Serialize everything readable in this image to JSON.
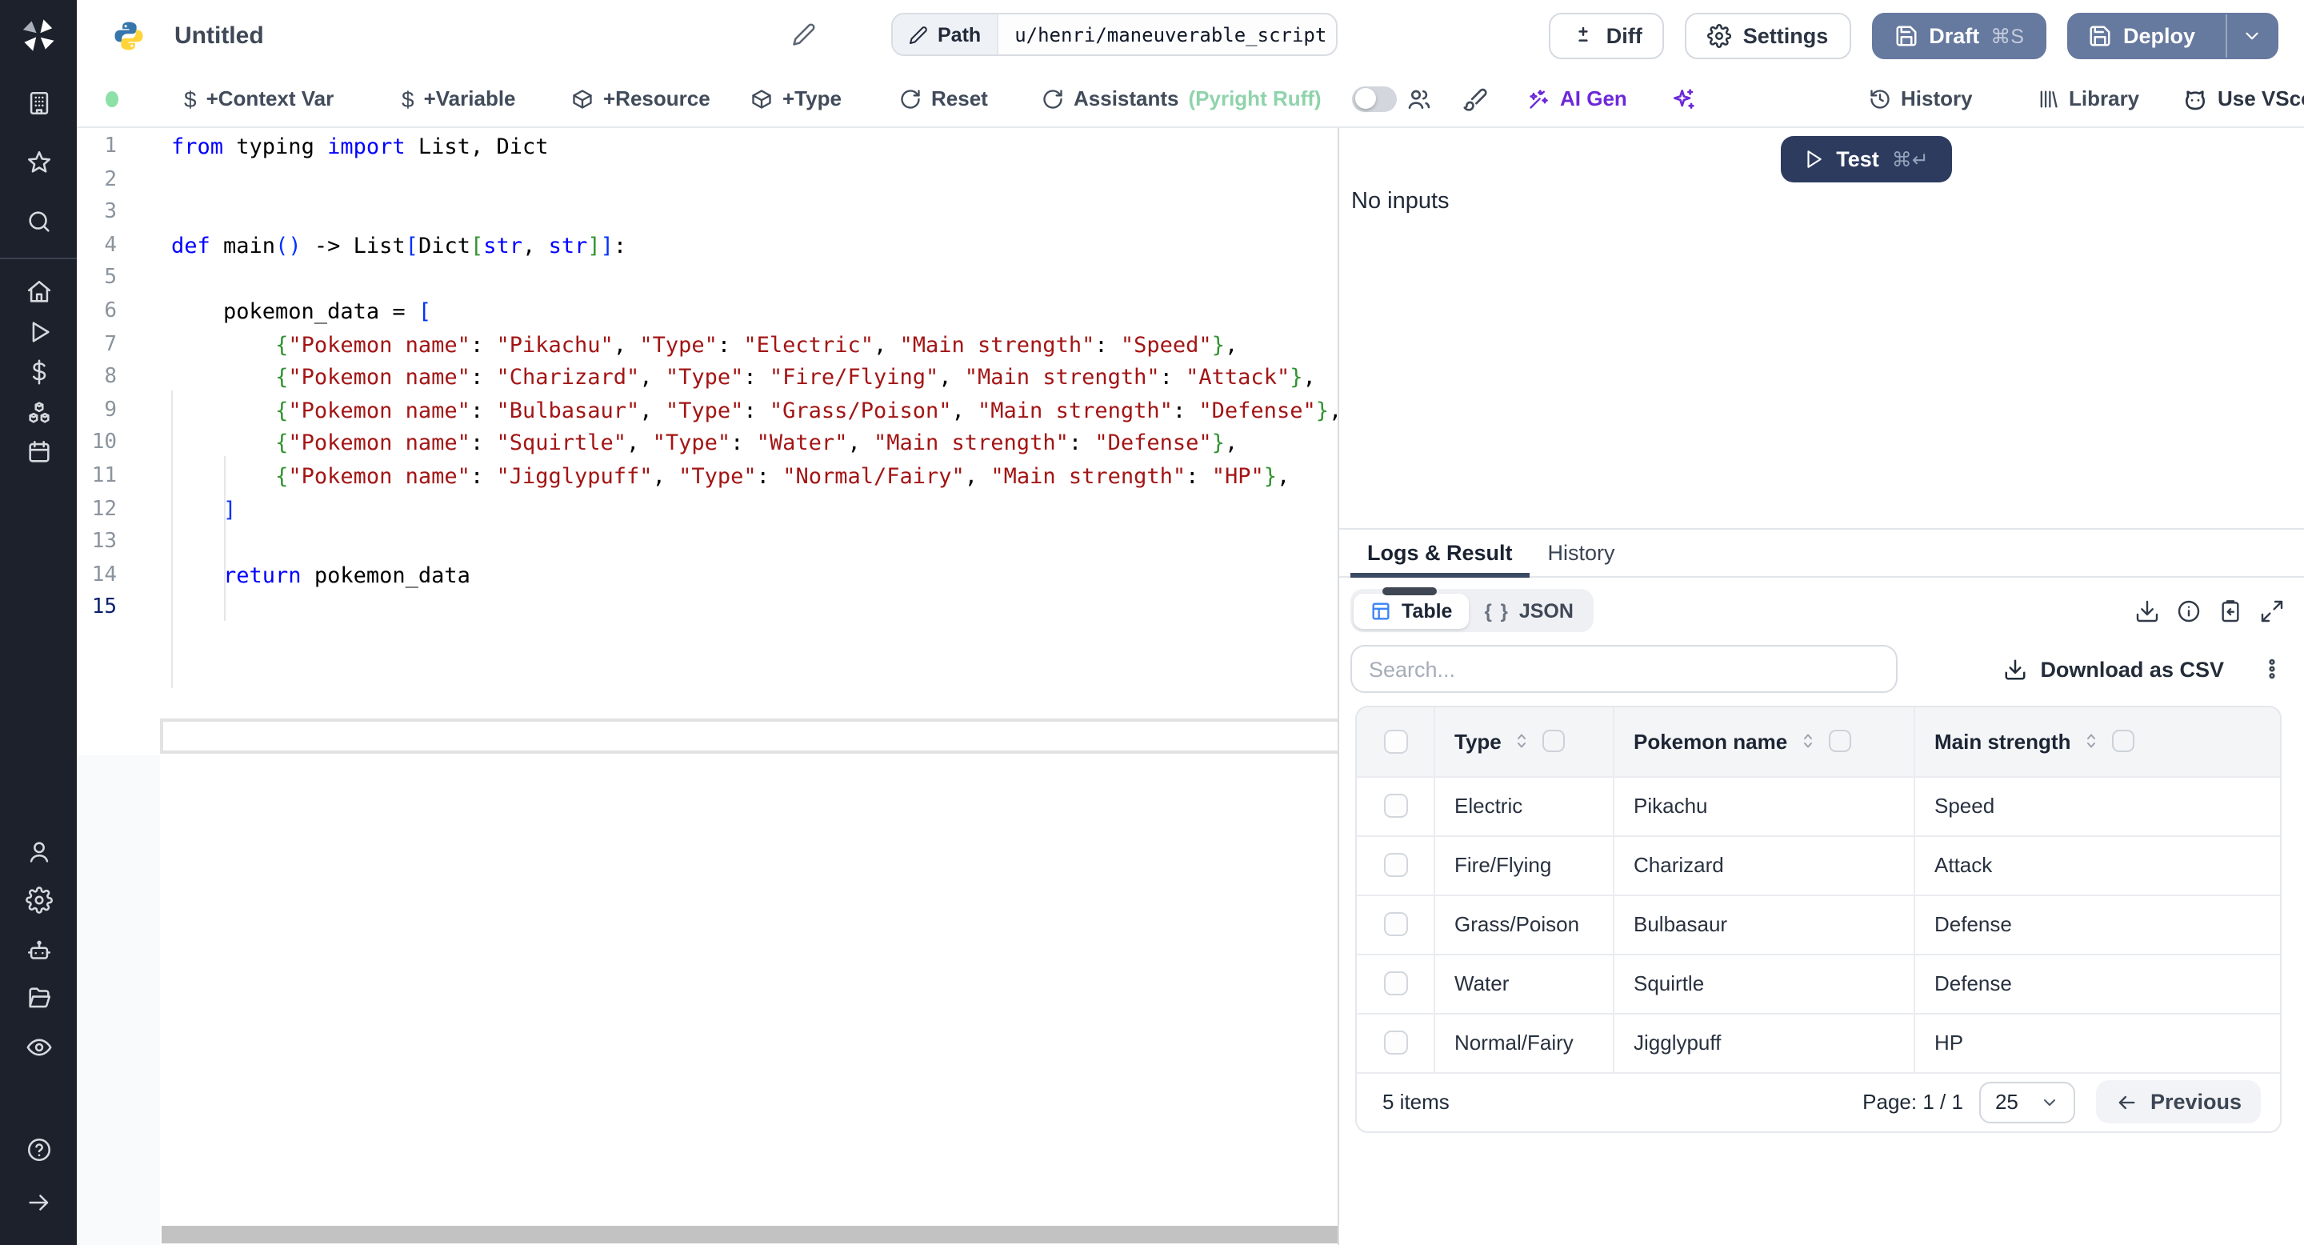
{
  "topbar": {
    "title": "Untitled",
    "path_label": "Path",
    "path_value": "u/henri/maneuverable_script",
    "diff_label": "Diff",
    "settings_label": "Settings",
    "draft_label": "Draft",
    "draft_shortcut": "⌘S",
    "deploy_label": "Deploy"
  },
  "toolbar": {
    "context_var": "+Context Var",
    "variable": "+Variable",
    "resource": "+Resource",
    "type": "+Type",
    "reset": "Reset",
    "assistants": "Assistants",
    "assistants_detail": "(Pyright Ruff)",
    "ai_gen": "AI Gen",
    "history": "History",
    "library": "Library",
    "vscode": "Use VScode"
  },
  "editor": {
    "language": "python",
    "lines": [
      {
        "n": "1",
        "segs": [
          [
            "kw",
            "from"
          ],
          [
            "pl",
            " typing "
          ],
          [
            "kw",
            "import"
          ],
          [
            "pl",
            " List, Dict"
          ]
        ]
      },
      {
        "n": "2",
        "segs": []
      },
      {
        "n": "3",
        "segs": []
      },
      {
        "n": "4",
        "segs": [
          [
            "kw",
            "def"
          ],
          [
            "pl",
            " main"
          ],
          [
            "b1",
            "()"
          ],
          [
            "pl",
            " -> List"
          ],
          [
            "b1",
            "["
          ],
          [
            "pl",
            "Dict"
          ],
          [
            "b2",
            "["
          ],
          [
            "kw",
            "str"
          ],
          [
            "pl",
            ", "
          ],
          [
            "kw",
            "str"
          ],
          [
            "b2",
            "]"
          ],
          [
            "b1",
            "]"
          ],
          [
            "pl",
            ":"
          ]
        ]
      },
      {
        "n": "5",
        "segs": []
      },
      {
        "n": "6",
        "segs": [
          [
            "pl",
            "    pokemon_data = "
          ],
          [
            "b1",
            "["
          ]
        ]
      },
      {
        "n": "7",
        "segs": [
          [
            "pl",
            "        "
          ],
          [
            "b2",
            "{"
          ],
          [
            "str",
            "\"Pokemon name\""
          ],
          [
            "pl",
            ": "
          ],
          [
            "str",
            "\"Pikachu\""
          ],
          [
            "pl",
            ", "
          ],
          [
            "str",
            "\"Type\""
          ],
          [
            "pl",
            ": "
          ],
          [
            "str",
            "\"Electric\""
          ],
          [
            "pl",
            ", "
          ],
          [
            "str",
            "\"Main strength\""
          ],
          [
            "pl",
            ": "
          ],
          [
            "str",
            "\"Speed\""
          ],
          [
            "b2",
            "}"
          ],
          [
            "pl",
            ","
          ]
        ]
      },
      {
        "n": "8",
        "segs": [
          [
            "pl",
            "        "
          ],
          [
            "b2",
            "{"
          ],
          [
            "str",
            "\"Pokemon name\""
          ],
          [
            "pl",
            ": "
          ],
          [
            "str",
            "\"Charizard\""
          ],
          [
            "pl",
            ", "
          ],
          [
            "str",
            "\"Type\""
          ],
          [
            "pl",
            ": "
          ],
          [
            "str",
            "\"Fire/Flying\""
          ],
          [
            "pl",
            ", "
          ],
          [
            "str",
            "\"Main strength\""
          ],
          [
            "pl",
            ": "
          ],
          [
            "str",
            "\"Attack\""
          ],
          [
            "b2",
            "}"
          ],
          [
            "pl",
            ","
          ]
        ]
      },
      {
        "n": "9",
        "segs": [
          [
            "pl",
            "        "
          ],
          [
            "b2",
            "{"
          ],
          [
            "str",
            "\"Pokemon name\""
          ],
          [
            "pl",
            ": "
          ],
          [
            "str",
            "\"Bulbasaur\""
          ],
          [
            "pl",
            ", "
          ],
          [
            "str",
            "\"Type\""
          ],
          [
            "pl",
            ": "
          ],
          [
            "str",
            "\"Grass/Poison\""
          ],
          [
            "pl",
            ", "
          ],
          [
            "str",
            "\"Main strength\""
          ],
          [
            "pl",
            ": "
          ],
          [
            "str",
            "\"Defense\""
          ],
          [
            "b2",
            "}"
          ],
          [
            "pl",
            ","
          ]
        ]
      },
      {
        "n": "10",
        "segs": [
          [
            "pl",
            "        "
          ],
          [
            "b2",
            "{"
          ],
          [
            "str",
            "\"Pokemon name\""
          ],
          [
            "pl",
            ": "
          ],
          [
            "str",
            "\"Squirtle\""
          ],
          [
            "pl",
            ", "
          ],
          [
            "str",
            "\"Type\""
          ],
          [
            "pl",
            ": "
          ],
          [
            "str",
            "\"Water\""
          ],
          [
            "pl",
            ", "
          ],
          [
            "str",
            "\"Main strength\""
          ],
          [
            "pl",
            ": "
          ],
          [
            "str",
            "\"Defense\""
          ],
          [
            "b2",
            "}"
          ],
          [
            "pl",
            ","
          ]
        ]
      },
      {
        "n": "11",
        "segs": [
          [
            "pl",
            "        "
          ],
          [
            "b2",
            "{"
          ],
          [
            "str",
            "\"Pokemon name\""
          ],
          [
            "pl",
            ": "
          ],
          [
            "str",
            "\"Jigglypuff\""
          ],
          [
            "pl",
            ", "
          ],
          [
            "str",
            "\"Type\""
          ],
          [
            "pl",
            ": "
          ],
          [
            "str",
            "\"Normal/Fairy\""
          ],
          [
            "pl",
            ", "
          ],
          [
            "str",
            "\"Main strength\""
          ],
          [
            "pl",
            ": "
          ],
          [
            "str",
            "\"HP\""
          ],
          [
            "b2",
            "}"
          ],
          [
            "pl",
            ","
          ]
        ]
      },
      {
        "n": "12",
        "segs": [
          [
            "pl",
            "    "
          ],
          [
            "b1",
            "]"
          ]
        ]
      },
      {
        "n": "13",
        "segs": []
      },
      {
        "n": "14",
        "segs": [
          [
            "pl",
            "    "
          ],
          [
            "kw",
            "return"
          ],
          [
            "pl",
            " pokemon_data"
          ]
        ]
      },
      {
        "n": "15",
        "segs": [],
        "active": true
      }
    ]
  },
  "run_panel": {
    "test_label": "Test",
    "test_shortcut": "⌘↵",
    "no_inputs": "No inputs"
  },
  "result_panel": {
    "tabs": {
      "logs": "Logs & Result",
      "history": "History"
    },
    "view_toggle": {
      "table": "Table",
      "json": "JSON",
      "json_icon": "{ }"
    },
    "search_placeholder": "Search...",
    "download_csv": "Download as CSV",
    "table": {
      "columns": [
        "Type",
        "Pokemon name",
        "Main strength"
      ],
      "rows": [
        [
          "Electric",
          "Pikachu",
          "Speed"
        ],
        [
          "Fire/Flying",
          "Charizard",
          "Attack"
        ],
        [
          "Grass/Poison",
          "Bulbasaur",
          "Defense"
        ],
        [
          "Water",
          "Squirtle",
          "Defense"
        ],
        [
          "Normal/Fairy",
          "Jigglypuff",
          "HP"
        ]
      ]
    },
    "footer": {
      "items_count": "5 items",
      "page_label": "Page: 1 / 1",
      "page_size": "25",
      "previous_label": "Previous"
    }
  },
  "colors": {
    "sidebar_bg": "#1c212b",
    "accent_slate": "#66799f",
    "dark_navy": "#2d3b5f",
    "ai_purple": "#6d28d9",
    "success_green": "#8ce0a8",
    "assistants_green": "#8fd3ab",
    "table_icon_blue": "#3b82f6",
    "keyword_blue": "#0000ff",
    "string_red": "#a31515",
    "bracket_blue": "#0431fa",
    "bracket_green": "#319331"
  }
}
